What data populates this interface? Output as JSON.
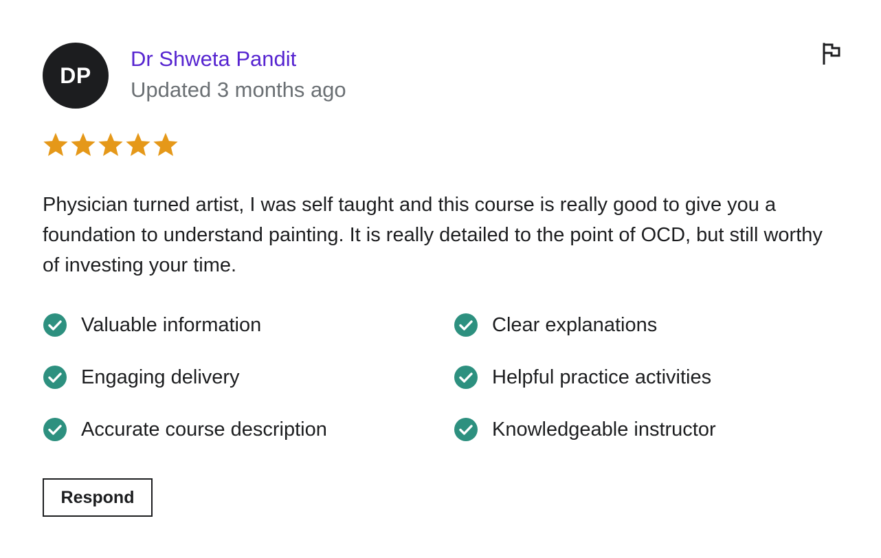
{
  "review": {
    "avatar_initials": "DP",
    "reviewer_name": "Dr Shweta Pandit",
    "updated_text": "Updated 3 months ago",
    "rating": 5,
    "rating_max": 5,
    "body": "Physician turned artist, I was self taught and this course is really good to give you a foundation to understand painting. It is really detailed to the point of OCD, but still worthy of investing your time.",
    "tags": [
      {
        "label": "Valuable information"
      },
      {
        "label": "Clear explanations"
      },
      {
        "label": "Engaging delivery"
      },
      {
        "label": "Helpful practice activities"
      },
      {
        "label": "Accurate course description"
      },
      {
        "label": "Knowledgeable instructor"
      }
    ],
    "respond_label": "Respond"
  },
  "icons": {
    "star": "star-icon",
    "check": "check-circle-icon",
    "flag": "flag-icon"
  },
  "colors": {
    "accent_purple": "#5624d0",
    "star": "#e59819",
    "check": "#2d907f",
    "avatar_bg": "#1c1d1f",
    "muted_text": "#6a6f73"
  }
}
